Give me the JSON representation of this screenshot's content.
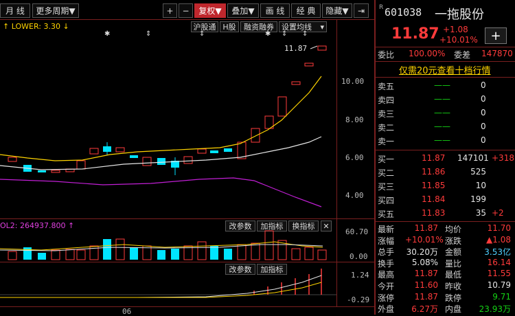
{
  "toolbar": {
    "period": "月 线",
    "more_period": "更多周期",
    "plus": "+",
    "minus": "−",
    "adjust": "复权",
    "overlay": "叠加",
    "draw": "画 线",
    "classic": "经 典",
    "hide": "隐藏"
  },
  "main_chart": {
    "indicator_text": "LOWER: 3.30",
    "tags": [
      "沪股通",
      "H股",
      "融资融券",
      "设置均线"
    ],
    "last_price_label": "11.87",
    "y_ticks": [
      "10.00",
      "8.00",
      "6.00",
      "4.00"
    ]
  },
  "vol_panel": {
    "label": "OL2: 264937.800",
    "buttons": [
      "改参数",
      "加指标",
      "换指标"
    ],
    "y_ticks": [
      "60.70",
      "0.00"
    ]
  },
  "macd_panel": {
    "buttons": [
      "改参数",
      "加指标"
    ],
    "y_ticks": [
      "1.24",
      "-0.29"
    ]
  },
  "x_axis": {
    "label": "06"
  },
  "stock": {
    "code": "601038",
    "name": "一拖股份",
    "price": "11.87",
    "change": "+1.08",
    "change_pct": "+10.01%",
    "weibi_label": "委比",
    "weibi": "100.00%",
    "weicha_label": "委差",
    "weicha": "147870",
    "l2_link": "仅需20元查看十档行情"
  },
  "asks": [
    {
      "label": "卖五",
      "price": "——",
      "vol": "0"
    },
    {
      "label": "卖四",
      "price": "——",
      "vol": "0"
    },
    {
      "label": "卖三",
      "price": "——",
      "vol": "0"
    },
    {
      "label": "卖二",
      "price": "——",
      "vol": "0"
    },
    {
      "label": "卖一",
      "price": "——",
      "vol": "0"
    }
  ],
  "bids": [
    {
      "label": "买一",
      "price": "11.87",
      "vol": "147101",
      "delta": "+318"
    },
    {
      "label": "买二",
      "price": "11.86",
      "vol": "525",
      "delta": ""
    },
    {
      "label": "买三",
      "price": "11.85",
      "vol": "10",
      "delta": ""
    },
    {
      "label": "买四",
      "price": "11.84",
      "vol": "199",
      "delta": ""
    },
    {
      "label": "买五",
      "price": "11.83",
      "vol": "35",
      "delta": "+2"
    }
  ],
  "quote": [
    {
      "l1": "最新",
      "v1": "11.87",
      "c1": "red",
      "l2": "均价",
      "v2": "11.70",
      "c2": "red"
    },
    {
      "l1": "涨幅",
      "v1": "+10.01%",
      "c1": "red",
      "l2": "涨跌",
      "v2": "▲1.08",
      "c2": "red"
    },
    {
      "l1": "总手",
      "v1": "30.20万",
      "c1": "white",
      "l2": "金额",
      "v2": "3.53亿",
      "c2": "cyan"
    },
    {
      "l1": "换手",
      "v1": "5.08%",
      "c1": "white",
      "l2": "量比",
      "v2": "16.14",
      "c2": "red"
    },
    {
      "l1": "最高",
      "v1": "11.87",
      "c1": "red",
      "l2": "最低",
      "v2": "11.55",
      "c2": "red"
    },
    {
      "l1": "今开",
      "v1": "11.60",
      "c1": "red",
      "l2": "昨收",
      "v2": "10.79",
      "c2": "white"
    },
    {
      "l1": "涨停",
      "v1": "11.87",
      "c1": "red",
      "l2": "跌停",
      "v2": "9.71",
      "c2": "green"
    },
    {
      "l1": "外盘",
      "v1": "6.27万",
      "c1": "red",
      "l2": "内盘",
      "v2": "23.93万",
      "c2": "green"
    }
  ],
  "colors": {
    "up": "#ff3b3b",
    "down": "#14d314",
    "ma_yellow": "#ffd400",
    "ma_white": "#e6e6e6",
    "ma_purple": "#c21fd6",
    "border": "#7a1f1f"
  }
}
